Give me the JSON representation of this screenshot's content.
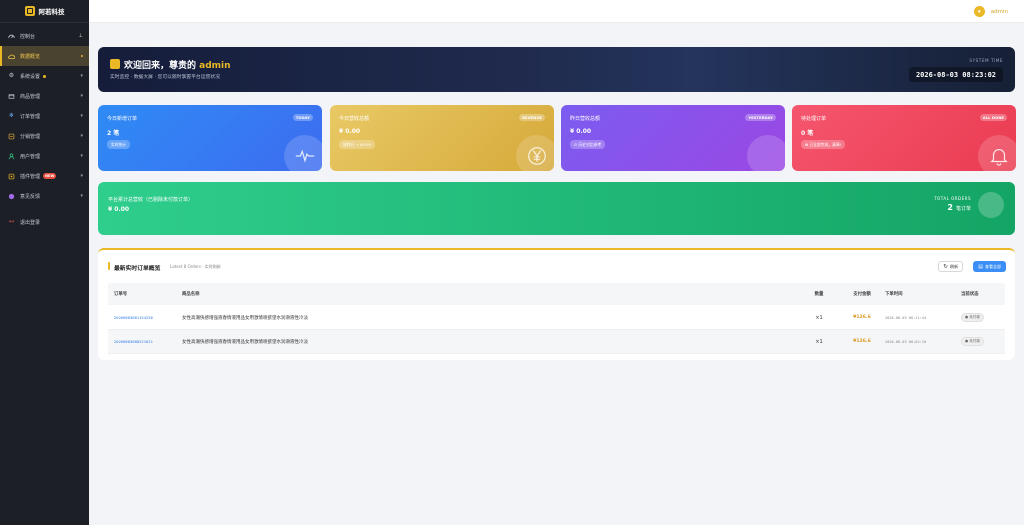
{
  "brand": {
    "name": "阿若科技"
  },
  "sidebar": {
    "items": [
      {
        "label": "控制台",
        "icon": "dashboard-icon",
        "arrow": "pin"
      },
      {
        "label": "数据概览",
        "icon": "cloud-icon",
        "active": true
      },
      {
        "label": "系统设置",
        "icon": "gear-icon"
      },
      {
        "label": "商品管理",
        "icon": "cart-icon"
      },
      {
        "label": "订单管理",
        "icon": "snowflake-icon"
      },
      {
        "label": "分销管理",
        "icon": "share-icon"
      },
      {
        "label": "用户管理",
        "icon": "user-icon"
      },
      {
        "label": "插件管理",
        "icon": "plugin-icon",
        "badge": "NEW"
      },
      {
        "label": "意见反馈",
        "icon": "feedback-icon"
      },
      {
        "label": "退出登录",
        "icon": "logout-icon"
      }
    ]
  },
  "topbar": {
    "username": "admin"
  },
  "banner": {
    "greeting": "欢迎回来，尊贵的",
    "user": "admin",
    "subtitle": "实时监控 · 数据大屏 · 您可以随时掌握平台运营状况",
    "system_time_label": "SYSTEM TIME",
    "system_time": "2026-08-03 08:23:02"
  },
  "cards": [
    {
      "title": "今日新增订单",
      "tag": "TODAY",
      "value": "2 笔",
      "pill": "实时统计"
    },
    {
      "title": "今日营收总额",
      "tag": "REVENUE",
      "value": "¥ 0.00",
      "pill": "较昨日 + 99.00"
    },
    {
      "title": "昨日营收总额",
      "tag": "YESTERDAY",
      "value": "¥ 0.00",
      "pill": "⊙ 历史对比参考"
    },
    {
      "title": "待处理订单",
      "tag": "ALL DONE",
      "value": "0 笔",
      "pill": "✿ 已全部完成，真棒!"
    }
  ],
  "total": {
    "title": "平台累计总营收（已剔除未付款订单）",
    "value": "¥ 0.00",
    "label": "TOTAL ORDERS",
    "count": "2",
    "unit": "笔订单"
  },
  "orders": {
    "title": "最新实时订单概览",
    "subtitle": "Latest 8 Orders · 实时刷新",
    "refresh_label": "刷新",
    "view_all_label": "查看全部",
    "columns": [
      "订单号",
      "商品名称",
      "数量",
      "支付金额",
      "下单时间",
      "当前状态"
    ],
    "rows": [
      {
        "id": "20260803081154256",
        "name": "女性高潮快感增强液春情液用品女用激情喷欲望水润滑液性冷淡",
        "qty": "×1",
        "amount": "¥126.6",
        "time": "2026-08-03 08:11:44",
        "status": "● 未付款"
      },
      {
        "id": "20260803080221621",
        "name": "女性高潮快感增强液春情液用品女用激情喷欲望水润滑液性冷淡",
        "qty": "×1",
        "amount": "¥126.6",
        "time": "2026-08-03 08:02:10",
        "status": "● 未付款"
      }
    ]
  },
  "colors": {
    "accent": "#e9b824",
    "sidebar_bg": "#1c1f26",
    "card_blue": "#2f8bf5",
    "card_gold": "#d6a93a",
    "card_purple": "#8a52ea",
    "card_red": "#f04a61",
    "card_green": "#20b877",
    "link_blue": "#2f7be6"
  }
}
